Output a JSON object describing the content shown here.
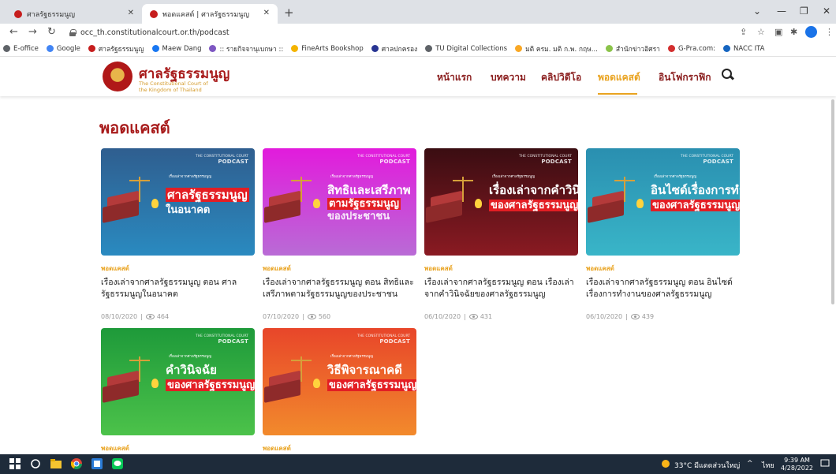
{
  "browser": {
    "tabs": [
      {
        "title": "ศาลรัฐธรรมนูญ",
        "active": false
      },
      {
        "title": "พอดแคสต์ | ศาลรัฐธรรมนูญ",
        "active": true
      }
    ],
    "url": "occ_th.constitutionalcourt.or.th/podcast",
    "bookmarks": [
      {
        "label": "E-office",
        "color": "#5f6368"
      },
      {
        "label": "Google",
        "color": "#4285f4"
      },
      {
        "label": "ศาลรัฐธรรมนูญ",
        "color": "#c61d1d"
      },
      {
        "label": "Maew Dang",
        "color": "#1877f2"
      },
      {
        "label": ":: รายกิจจานุเบกษา ::",
        "color": "#7e57c2"
      },
      {
        "label": "FineArts Bookshop",
        "color": "#f4b400"
      },
      {
        "label": "ศาลปกครอง",
        "color": "#283593"
      },
      {
        "label": "TU Digital Collections",
        "color": "#5f6368"
      },
      {
        "label": "มติ ครม. มติ ก.พ. กฤษ...",
        "color": "#f9a825"
      },
      {
        "label": "สำนักข่าวอิศรา",
        "color": "#8bc34a"
      },
      {
        "label": "G-Pra.com:",
        "color": "#d32f2f"
      },
      {
        "label": "NACC ITA",
        "color": "#1565c0"
      }
    ]
  },
  "site": {
    "name": "ศาลรัฐธรรมนูญ",
    "subtitle": "The Constitutional Court of the Kingdom of Thailand",
    "nav": [
      {
        "label": "หน้าแรก",
        "active": false
      },
      {
        "label": "บทความ",
        "active": false
      },
      {
        "label": "คลิปวิดีโอ",
        "active": false
      },
      {
        "label": "พอดแคสต์",
        "active": true
      },
      {
        "label": "อินโฟกราฟิก",
        "active": false
      }
    ],
    "brand_colors": {
      "primary": "#a81b1b",
      "accent": "#e9a320"
    }
  },
  "page": {
    "title": "พอดแคสต์",
    "cards": [
      {
        "thumb_brand_top": "THE CONSTITUTIONAL COURT",
        "thumb_brand": "PODCAST",
        "thumb_sub": "เรื่องเล่าจากศาลรัฐธรรมนูญ",
        "thumb_line1": "ศาลรัฐธรรมนูญ",
        "thumb_line2": "ในอนาคต",
        "bg": "linear-gradient(180deg,#2f5e8f,#2a8ac0)",
        "category": "พอดแคสต์",
        "title": "เรื่องเล่าจากศาลรัฐธรรมนูญ ตอน ศาลรัฐธรรมนูญในอนาคต",
        "date": "08/10/2020",
        "views": "464"
      },
      {
        "thumb_brand_top": "THE CONSTITUTIONAL COURT",
        "thumb_brand": "PODCAST",
        "thumb_sub": "เรื่องเล่าจากศาลรัฐธรรมนูญ",
        "thumb_line1": "สิทธิและเสรีภาพ",
        "thumb_line2": "ตามรัฐธรรมนูญ",
        "thumb_line3": "ของประชาชน",
        "bg": "linear-gradient(180deg,#e21bdc,#b96bd6)",
        "category": "พอดแคสต์",
        "title": "เรื่องเล่าจากศาลรัฐธรรมนูญ ตอน สิทธิและเสรีภาพตามรัฐธรรมนูญของประชาชน",
        "date": "07/10/2020",
        "views": "560"
      },
      {
        "thumb_brand_top": "THE CONSTITUTIONAL COURT",
        "thumb_brand": "PODCAST",
        "thumb_sub": "เรื่องเล่าจากศาลรัฐธรรมนูญ",
        "thumb_line1": "เรื่องเล่าจากคำวินิจ",
        "thumb_line2": "ของศาลรัฐธรรมนูญ",
        "bg": "linear-gradient(180deg,#3a0d12,#8a1a22)",
        "category": "พอดแคสต์",
        "title": "เรื่องเล่าจากศาลรัฐธรรมนูญ ตอน เรื่องเล่าจากคำวินิจฉัยของศาลรัฐธรรมนูญ",
        "date": "06/10/2020",
        "views": "431"
      },
      {
        "thumb_brand_top": "THE CONSTITUTIONAL COURT",
        "thumb_brand": "PODCAST",
        "thumb_sub": "เรื่องเล่าจากศาลรัฐธรรมนูญ",
        "thumb_line1": "อินไซด์เรื่องการทำงา",
        "thumb_line2": "ของศาลรัฐธรรมนูญ",
        "bg": "linear-gradient(180deg,#2a8fb0,#39b5c8)",
        "category": "พอดแคสต์",
        "title": "เรื่องเล่าจากศาลรัฐธรรมนูญ ตอน อินไซด์เรื่องการทำงานของศาลรัฐธรรมนูญ",
        "date": "06/10/2020",
        "views": "439"
      },
      {
        "thumb_brand_top": "THE CONSTITUTIONAL COURT",
        "thumb_brand": "PODCAST",
        "thumb_sub": "เรื่องเล่าจากศาลรัฐธรรมนูญ",
        "thumb_line1": "คำวินิจฉัย",
        "thumb_line2": "ของศาลรัฐธรรมนูญ",
        "bg": "linear-gradient(180deg,#1e9a3a,#4cc24a)",
        "category": "พอดแคสต์"
      },
      {
        "thumb_brand_top": "THE CONSTITUTIONAL COURT",
        "thumb_brand": "PODCAST",
        "thumb_sub": "เรื่องเล่าจากศาลรัฐธรรมนูญ",
        "thumb_line1": "วิธีพิจารณาคดี",
        "thumb_line2": "ของศาลรัฐธรรมนูญ",
        "bg": "linear-gradient(180deg,#e8462a,#f28a2c)",
        "category": "พอดแคสต์"
      }
    ]
  },
  "taskbar": {
    "weather": "33°C มีแดดส่วนใหญ่",
    "lang": "ไทย",
    "time": "9:39 AM",
    "date": "4/28/2022"
  }
}
